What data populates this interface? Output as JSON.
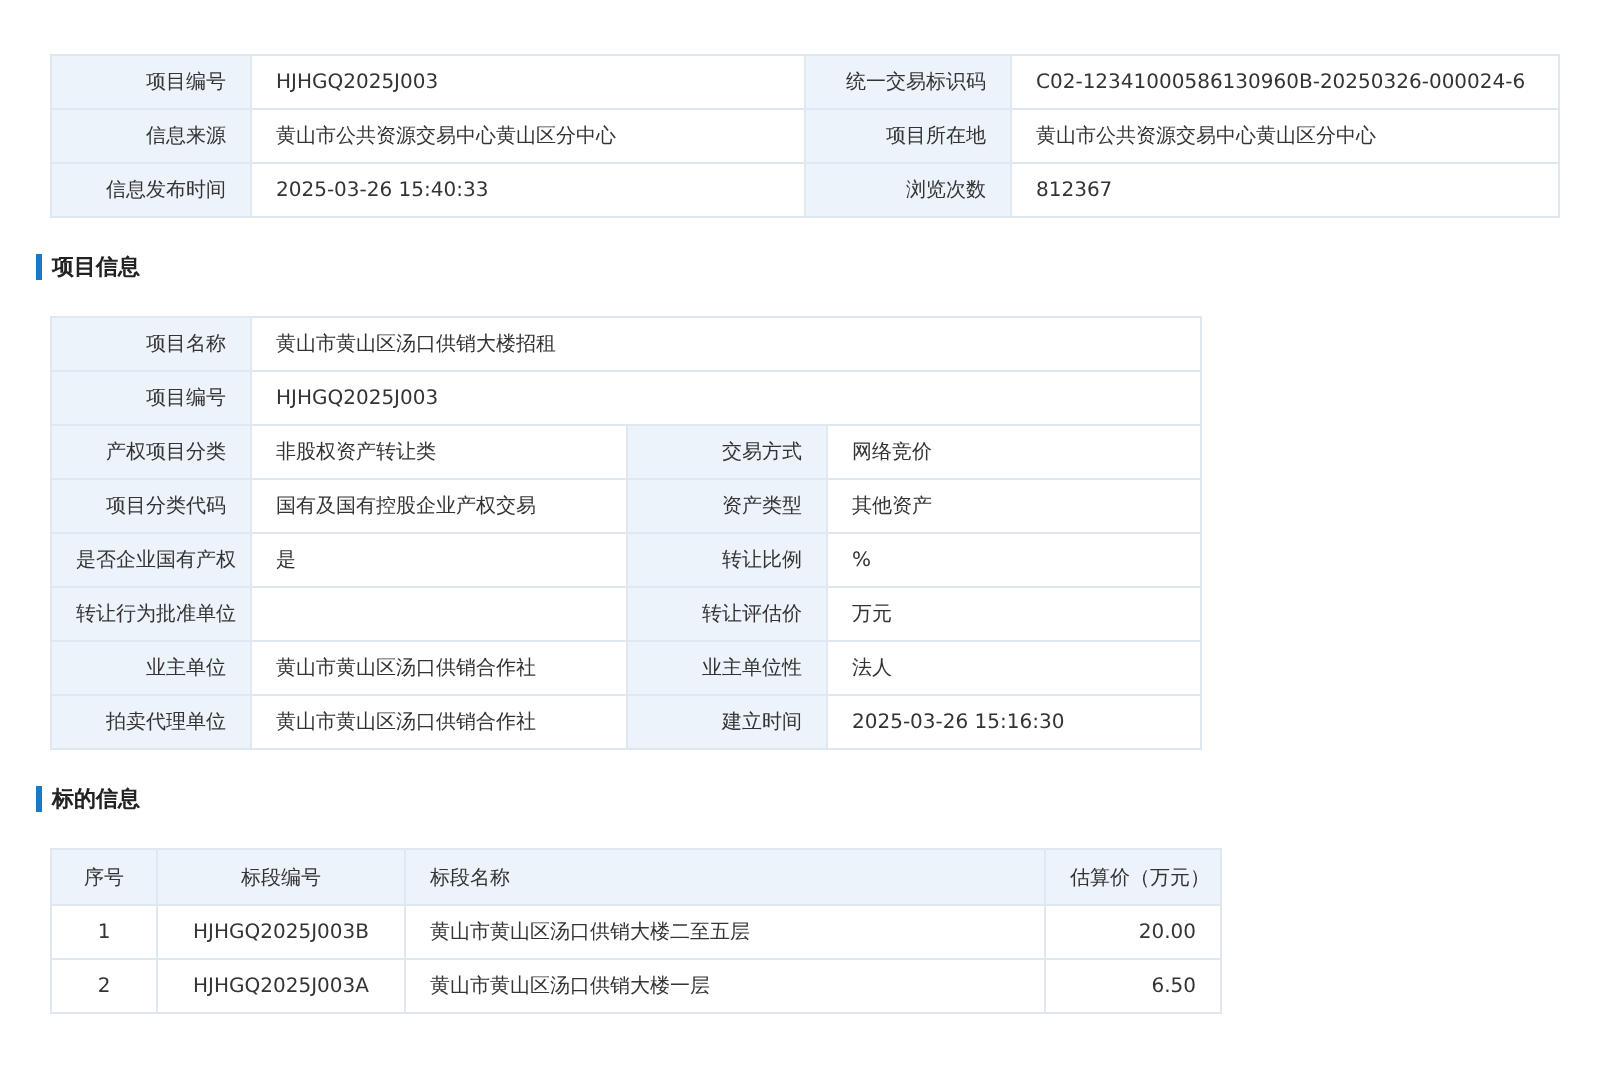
{
  "summary": {
    "rows": [
      [
        {
          "label": "项目编号",
          "value": "HJHGQ2025J003"
        },
        {
          "label": "统一交易标识码",
          "value": "C02-12341000586130960B-20250326-000024-6"
        }
      ],
      [
        {
          "label": "信息来源",
          "value": "黄山市公共资源交易中心黄山区分中心"
        },
        {
          "label": "项目所在地",
          "value": "黄山市公共资源交易中心黄山区分中心"
        }
      ],
      [
        {
          "label": "信息发布时间",
          "value": "2025-03-26 15:40:33"
        },
        {
          "label": "浏览次数",
          "value": "812367"
        }
      ]
    ]
  },
  "project_info": {
    "title": "项目信息",
    "rows": [
      [
        {
          "label": "项目名称",
          "value": "黄山市黄山区汤口供销大楼招租"
        }
      ],
      [
        {
          "label": "项目编号",
          "value": "HJHGQ2025J003"
        }
      ],
      [
        {
          "label": "产权项目分类",
          "value": "非股权资产转让类"
        },
        {
          "label": "交易方式",
          "value": "网络竞价"
        }
      ],
      [
        {
          "label": "项目分类代码",
          "value": "国有及国有控股企业产权交易"
        },
        {
          "label": "资产类型",
          "value": "其他资产"
        }
      ],
      [
        {
          "label": "是否企业国有产权",
          "value": "是"
        },
        {
          "label": "转让比例",
          "value": "%"
        }
      ],
      [
        {
          "label": "转让行为批准单位"
        },
        {
          "label": "转让评估价",
          "value": "万元"
        }
      ],
      [
        {
          "label": "业主单位",
          "value": "黄山市黄山区汤口供销合作社"
        },
        {
          "label": "业主单位性",
          "value": "法人"
        }
      ],
      [
        {
          "label": "拍卖代理单位",
          "value": "黄山市黄山区汤口供销合作社"
        },
        {
          "label": "建立时间",
          "value": "2025-03-26 15:16:30"
        }
      ]
    ]
  },
  "lot_info": {
    "title": "标的信息",
    "columns": [
      "序号",
      "标段编号",
      "标段名称",
      "估算价（万元）"
    ],
    "rows": [
      [
        "1",
        "HJHGQ2025J003B",
        "黄山市黄山区汤口供销大楼二至五层",
        "20.00"
      ],
      [
        "2",
        "HJHGQ2025J003A",
        "黄山市黄山区汤口供销大楼一层",
        "6.50"
      ]
    ]
  }
}
